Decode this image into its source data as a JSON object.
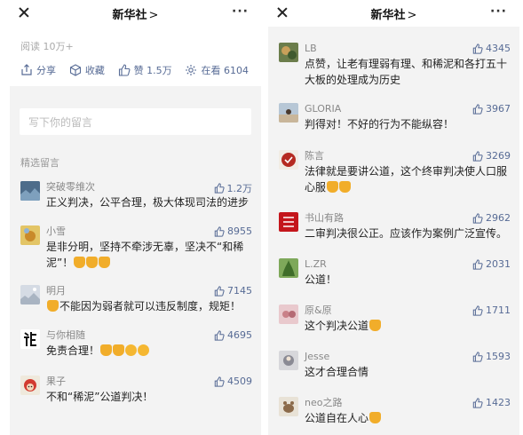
{
  "left": {
    "title": "新华社",
    "chevron": ">",
    "read_count": "阅读 10万+",
    "actions": [
      {
        "icon": "share-icon",
        "label": "分享"
      },
      {
        "icon": "collect-icon",
        "label": "收藏"
      },
      {
        "icon": "like-icon",
        "label": "赞 1.5万"
      },
      {
        "icon": "wow-icon",
        "label": "在看 6104"
      }
    ],
    "comment_placeholder": "写下你的留言",
    "section_label": "精选留言",
    "comments": [
      {
        "name": "突破零维次",
        "text": "正义判决，公平合理，极大体现司法的进步",
        "likes": "1.2万",
        "avatar_color": "#5a7e9e"
      },
      {
        "name": "小雪",
        "text": "是非分明，坚持不牵涉无辜，坚决不“和稀泥”！",
        "likes": "8955",
        "avatar_color": "#d8b14a"
      },
      {
        "name": "明月",
        "text": "不能因为弱者就可以违反制度，规矩！",
        "likes": "7145",
        "avatar_color": "#c9cfd8"
      },
      {
        "name": "与你相随",
        "text": "免责合理！",
        "likes": "4695",
        "avatar_color": "#ffffff"
      },
      {
        "name": "果子",
        "text": "不和“稀泥”公道判决！",
        "likes": "4509",
        "avatar_color": "#e6e1d4"
      }
    ]
  },
  "right": {
    "title": "新华社",
    "chevron": ">",
    "comments": [
      {
        "name": "LB",
        "text": "点赞，让老有理弱有理、和稀泥和各打五十大板的处理成为历史",
        "likes": "4345",
        "avatar_color": "#6b7d4b"
      },
      {
        "name": "GLORIA",
        "text": "判得对！不好的行为不能纵容！",
        "likes": "3967",
        "avatar_color": "#c9b69a"
      },
      {
        "name": "陈言",
        "text": "法律就是要讲公道，这个终审判决使人口服心服",
        "likes": "3269",
        "avatar_color": "#b52a20"
      },
      {
        "name": "书山有路",
        "text": "二审判决很公正。应该作为案例广泛宣传。",
        "likes": "2962",
        "avatar_color": "#c4161c"
      },
      {
        "name": "L.ZR",
        "text": "公道！",
        "likes": "2031",
        "avatar_color": "#5d8a3a"
      },
      {
        "name": "原&原",
        "text": "这个判决公道",
        "likes": "1711",
        "avatar_color": "#d9a3a8"
      },
      {
        "name": "Jesse",
        "text": "这才合理合情",
        "likes": "1593",
        "avatar_color": "#c8c8cc"
      },
      {
        "name": "neo之路",
        "text": "公道自在人心",
        "likes": "1423",
        "avatar_color": "#8b6a4a"
      }
    ]
  }
}
